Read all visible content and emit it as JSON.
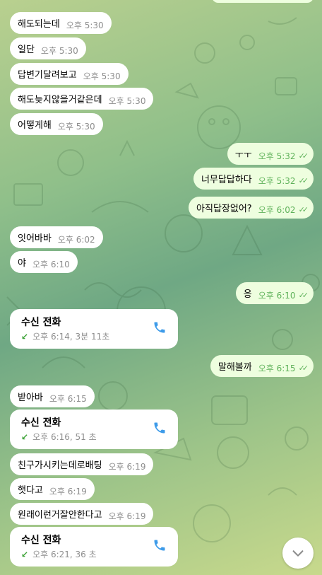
{
  "messages": [
    {
      "text": "해도되는데",
      "time": "오후 5:30"
    },
    {
      "text": "일단",
      "time": "오후 5:30"
    },
    {
      "text": "답변기달려보고",
      "time": "오후 5:30"
    },
    {
      "text": "해도늦지않을거같은데",
      "time": "오후 5:30"
    },
    {
      "text": "어떻게해",
      "time": "오후 5:30"
    },
    {
      "text": "ㅜㅜ",
      "time": "오후 5:32"
    },
    {
      "text": "너무답답하다",
      "time": "오후 5:32"
    },
    {
      "text": "아직답장없어?",
      "time": "오후 6:02"
    },
    {
      "text": "잇어바바",
      "time": "오후 6:02"
    },
    {
      "text": "야",
      "time": "오후 6:10"
    },
    {
      "text": "응",
      "time": "오후 6:10"
    },
    {
      "text": "말해볼까",
      "time": "오후 6:15"
    },
    {
      "text": "받아바",
      "time": "오후 6:15"
    },
    {
      "text": "친구가시키는데로배팅",
      "time": "오후 6:19"
    },
    {
      "text": "햇다고",
      "time": "오후 6:19"
    },
    {
      "text": "원래이런거잘안한다고",
      "time": "오후 6:19"
    }
  ],
  "calls": [
    {
      "title": "수신 전화",
      "detail": "오후 6:14, 3분 11초"
    },
    {
      "title": "수신 전화",
      "detail": "오후 6:16, 51 초"
    },
    {
      "title": "수신 전화",
      "detail": "오후 6:21, 36 초"
    }
  ],
  "colors": {
    "incoming_bubble": "#ffffff",
    "outgoing_bubble": "#eefedf",
    "read_ticks": "#5fb25a",
    "call_arrow": "#3fa43a",
    "phone_icon": "#3d9be9"
  }
}
